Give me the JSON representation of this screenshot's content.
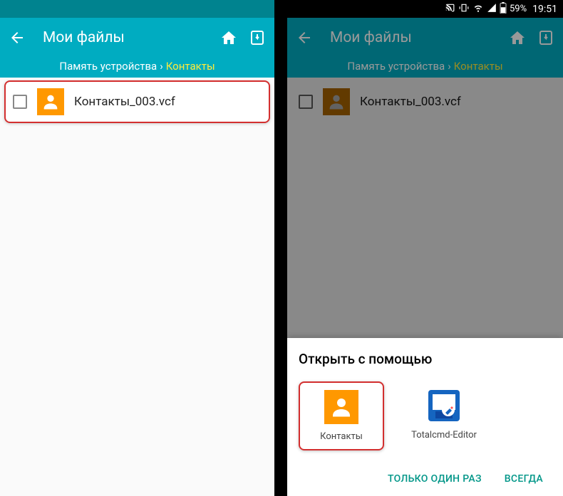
{
  "statusBar": {
    "battery": "59%",
    "time": "19:51"
  },
  "appBar": {
    "title": "Мои файлы"
  },
  "breadcrumb": {
    "parent": "Память устройства",
    "current": "Контакты"
  },
  "fileList": {
    "items": [
      {
        "name": "Контакты_003.vcf"
      }
    ]
  },
  "bottomSheet": {
    "title": "Открыть с помощью",
    "options": [
      {
        "label": "Контакты",
        "icon": "contacts"
      },
      {
        "label": "Totalcmd-Editor",
        "icon": "editor"
      }
    ],
    "actions": {
      "once": "ТОЛЬКО ОДИН РАЗ",
      "always": "ВСЕГДА"
    }
  }
}
